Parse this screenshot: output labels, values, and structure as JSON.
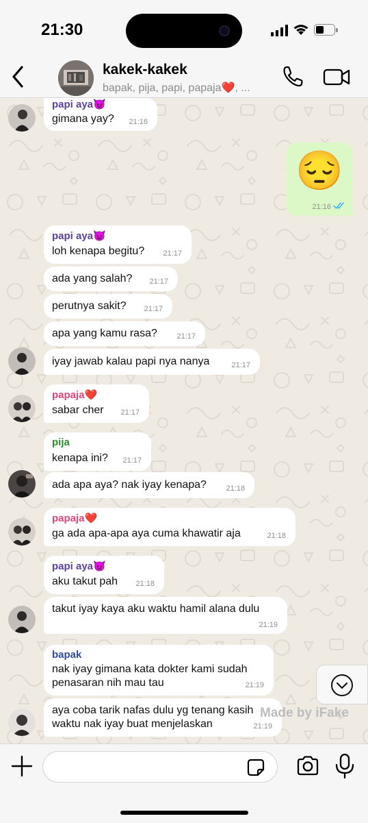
{
  "status_bar": {
    "time": "21:30",
    "battery_level": 0.45
  },
  "header": {
    "title": "kakek-kakek",
    "subtitle": "bapak, pija, papi, papaja❤️, ..."
  },
  "colors": {
    "outgoing_bubble": "#dcf8c6",
    "incoming_bubble": "#ffffff",
    "chat_bg": "#efeae2",
    "read_ticks": "#34b7f1",
    "sender_papi_aya": "#5a3f9d",
    "sender_papaja": "#e0457b",
    "sender_pija": "#2e8b2e",
    "sender_bapak": "#2f4a9f"
  },
  "messages": [
    {
      "sender": "papi aya😈",
      "text": "gimana yay?",
      "time": "21:16"
    },
    {
      "emoji": "😔",
      "time": "21:16",
      "status": "read"
    },
    {
      "sender": "papi aya😈",
      "text": "loh kenapa begitu?",
      "time": "21:17"
    },
    {
      "text": "ada yang salah?",
      "time": "21:17"
    },
    {
      "text": "perutnya sakit?",
      "time": "21:17"
    },
    {
      "text": "apa yang kamu rasa?",
      "time": "21:17"
    },
    {
      "text": "iyay jawab kalau papi nya nanya",
      "time": "21:17"
    },
    {
      "sender": "papaja❤️",
      "text": "sabar cher",
      "time": "21:17"
    },
    {
      "sender": "pija",
      "text": "kenapa ini?",
      "time": "21:17"
    },
    {
      "text": "ada apa aya? nak iyay kenapa?",
      "time": "21:18"
    },
    {
      "sender": "papaja❤️",
      "text": "ga ada apa-apa aya cuma khawatir aja",
      "time": "21:18"
    },
    {
      "sender": "papi aya😈",
      "text": "aku takut pah",
      "time": "21:18"
    },
    {
      "text": "takut iyay kaya aku waktu hamil alana dulu",
      "time": "21:19"
    },
    {
      "sender": "bapak",
      "line1": "nak iyay gimana kata dokter kami sudah",
      "line2": "penasaran nih mau tau",
      "time": "21:19"
    },
    {
      "line1": "aya coba tarik nafas dulu yg tenang kasih",
      "line2": "waktu nak iyay buat menjelaskan",
      "time": "21:19"
    }
  ],
  "watermark": "Made by iFake",
  "input": {
    "placeholder": ""
  }
}
